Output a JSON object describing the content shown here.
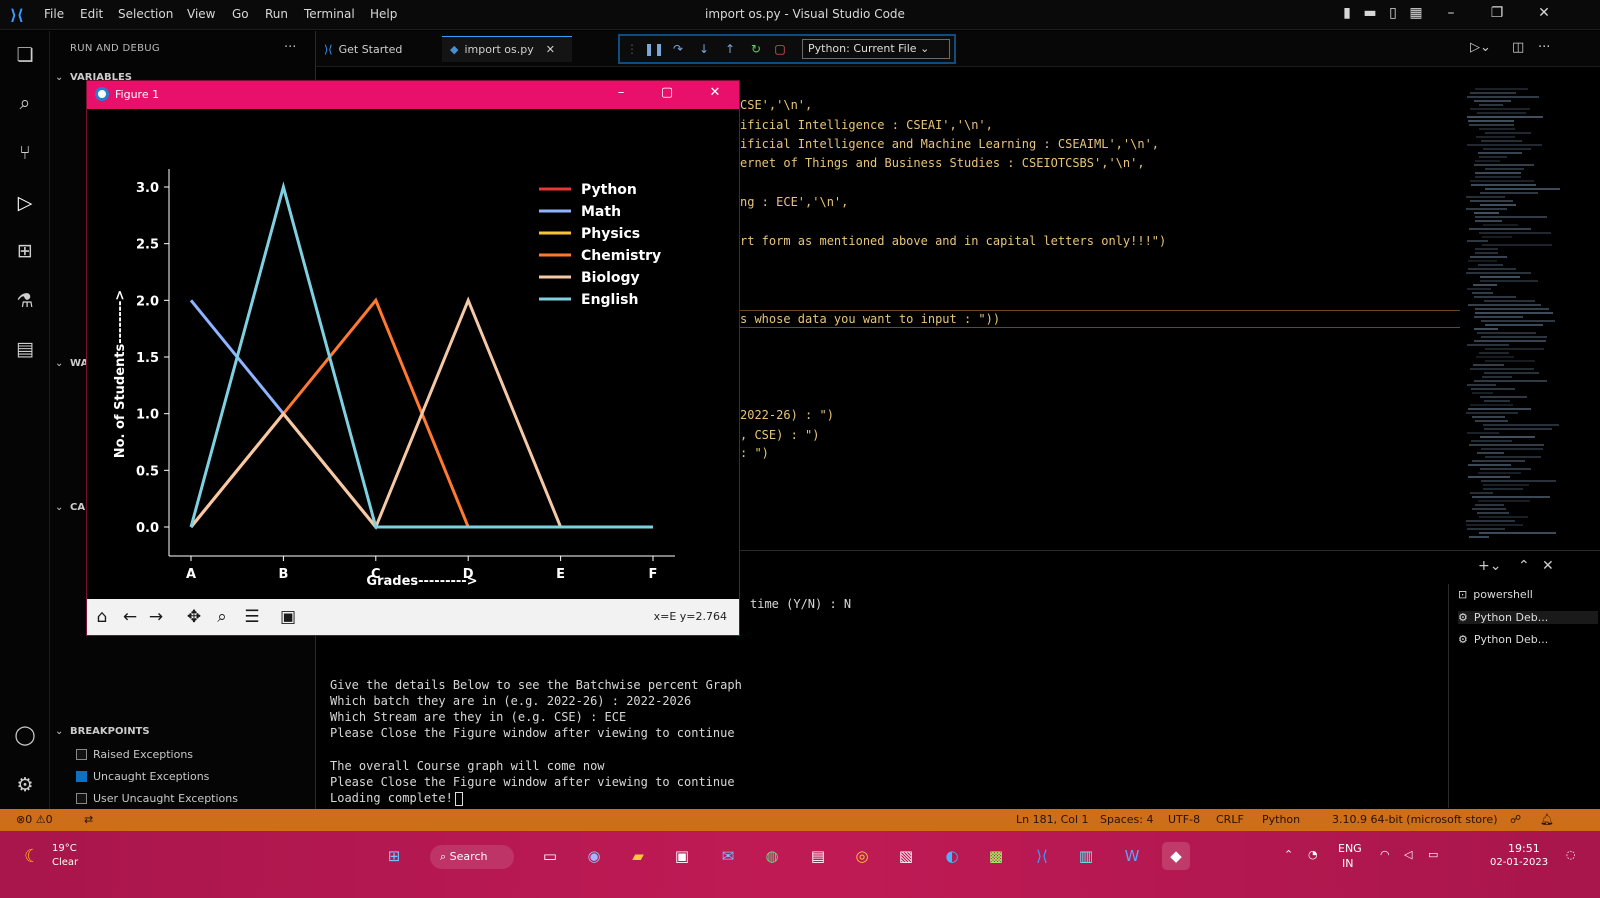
{
  "titlebar": {
    "menu": [
      "File",
      "Edit",
      "Selection",
      "View",
      "Go",
      "Run",
      "Terminal",
      "Help"
    ],
    "title": "import os.py - Visual Studio Code"
  },
  "sidebar": {
    "title": "RUN AND DEBUG",
    "sections": [
      "VARIABLES",
      "WA",
      "CA",
      "BREAKPOINTS"
    ],
    "breakpoints": [
      {
        "label": "Raised Exceptions",
        "checked": false
      },
      {
        "label": "Uncaught Exceptions",
        "checked": true
      },
      {
        "label": "User Uncaught Exceptions",
        "checked": false
      }
    ]
  },
  "tabs": [
    {
      "label": "Get Started"
    },
    {
      "label": "import os.py"
    }
  ],
  "debug": {
    "config": "Python: Current File"
  },
  "editor": {
    "lines": [
      "CSE','\\n',",
      "ificial Intelligence : CSEAI','\\n',",
      "ificial Intelligence and Machine Learning : CSEAIML','\\n',",
      "ernet of Things and Business Studies : CSEIOTCSBS','\\n',",
      "ng : ECE','\\n',",
      "rt form as mentioned above and in capital letters only!!!\")",
      "s whose data you want to input : \"))",
      "2022-26) : \")",
      ", CSE) : \")",
      ": \")"
    ]
  },
  "terminal": {
    "lines": [
      "time (Y/N) : N",
      "Give the details Below to see the Batchwise percent Graph",
      "Which batch they are in (e.g. 2022-26) : 2022-2026",
      "Which Stream are they in (e.g. CSE) : ECE",
      "Please Close the Figure window after viewing to continue",
      "The overall Course graph will come now",
      "Please Close the Figure window after viewing to continue",
      "Loading complete!"
    ],
    "sessions": [
      "powershell",
      "Python Deb...",
      "Python Deb..."
    ]
  },
  "statusbar": {
    "left": "⊗0 ⚠0",
    "items": [
      "Ln 181, Col 1",
      "Spaces: 4",
      "UTF-8",
      "CRLF",
      "Python",
      "3.10.9 64-bit (microsoft store)"
    ]
  },
  "taskbar": {
    "temp": "19°C",
    "weather": "Clear",
    "search": "Search",
    "lang": "ENG",
    "region": "IN",
    "time": "19:51",
    "date": "02-01-2023"
  },
  "figure": {
    "title": "Figure 1",
    "coords": "x=E y=2.764"
  },
  "chart_data": {
    "type": "line",
    "categories": [
      "A",
      "B",
      "C",
      "D",
      "E",
      "F"
    ],
    "ylim": [
      0,
      3.0
    ],
    "yticks": [
      "0.0",
      "0.5",
      "1.0",
      "1.5",
      "2.0",
      "2.5",
      "3.0"
    ],
    "xlabel": "Grades--------->",
    "ylabel": "No. of Students-------->",
    "legend": "top-right",
    "series": [
      {
        "name": "Python",
        "color": "#e53935",
        "values": [
          0,
          1,
          0,
          0,
          0,
          0
        ]
      },
      {
        "name": "Math",
        "color": "#8fb4ff",
        "values": [
          2,
          1,
          0,
          0,
          0,
          0
        ]
      },
      {
        "name": "Physics",
        "color": "#f9c43a",
        "values": [
          0,
          1,
          0,
          0,
          0,
          0
        ]
      },
      {
        "name": "Chemistry",
        "color": "#ff7a30",
        "values": [
          0,
          1,
          2,
          0,
          0,
          0
        ]
      },
      {
        "name": "Biology",
        "color": "#f6c9a6",
        "values": [
          0,
          1,
          0,
          2,
          0,
          0
        ]
      },
      {
        "name": "English",
        "color": "#7fd0e0",
        "values": [
          0,
          3,
          0,
          0,
          0,
          0
        ]
      }
    ]
  }
}
